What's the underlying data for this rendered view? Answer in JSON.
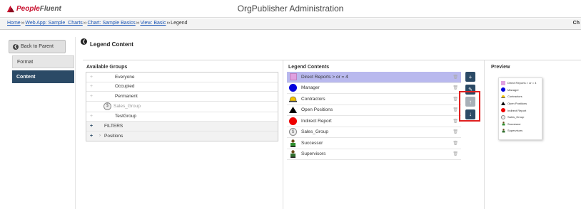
{
  "app": {
    "title": "OrgPublisher Administration",
    "logo_people": "People",
    "logo_fluent": "Fluent",
    "right_label": "Ch"
  },
  "breadcrumb": [
    {
      "label": "Home",
      "link": true
    },
    {
      "label": "Web App: Sample_Charts",
      "link": true
    },
    {
      "label": "Chart: Sample Basics",
      "link": true
    },
    {
      "label": "View: Basic",
      "link": true
    },
    {
      "label": "Legend",
      "link": false
    }
  ],
  "breadcrumb_sep": "››",
  "sidebar": {
    "back_label": "Back to Parent",
    "items": [
      {
        "label": "Format",
        "active": false
      },
      {
        "label": "Content",
        "active": true
      }
    ]
  },
  "page": {
    "title": "Legend Content"
  },
  "available_groups": {
    "header": "Available Groups",
    "rows": [
      {
        "label": "Everyone",
        "type": "group"
      },
      {
        "label": "Occupied",
        "type": "group"
      },
      {
        "label": "Permanent",
        "type": "group"
      },
      {
        "label": "Sales_Group",
        "type": "disabled",
        "icon": "dollar-icon"
      },
      {
        "label": "TestGroup",
        "type": "group"
      },
      {
        "label": "FILTERS",
        "type": "section"
      },
      {
        "label": "Positions",
        "type": "section-expand"
      }
    ]
  },
  "legend_contents": {
    "header": "Legend Contents",
    "rows": [
      {
        "label": "Direct Reports > or = 4",
        "icon": "pink-square-icon",
        "selected": true
      },
      {
        "label": "Manager",
        "icon": "blue-circle-icon",
        "selected": false
      },
      {
        "label": "Contractors",
        "icon": "hardhat-icon",
        "selected": false
      },
      {
        "label": "Open Positions",
        "icon": "black-triangle-icon",
        "selected": false
      },
      {
        "label": "Indirect Report",
        "icon": "red-circle-icon",
        "selected": false
      },
      {
        "label": "Sales_Group",
        "icon": "dollar-icon",
        "selected": false
      },
      {
        "label": "Successor",
        "icon": "successor-person-icon",
        "selected": false
      },
      {
        "label": "Supervisors",
        "icon": "supervisor-person-icon",
        "selected": false
      }
    ]
  },
  "preview": {
    "header": "Preview",
    "rows": [
      {
        "label": "Direct Reports > or = 4",
        "icon": "pink-square-icon"
      },
      {
        "label": "Manager",
        "icon": "blue-circle-icon"
      },
      {
        "label": "Contractors",
        "icon": "hardhat-icon"
      },
      {
        "label": "Open Positions",
        "icon": "black-triangle-icon"
      },
      {
        "label": "Indirect Report",
        "icon": "red-circle-icon"
      },
      {
        "label": "Sales_Group",
        "icon": "dollar-icon"
      },
      {
        "label": "Successor",
        "icon": "successor-person-icon"
      },
      {
        "label": "Supervisors",
        "icon": "supervisor-person-icon"
      }
    ]
  },
  "colors": {
    "accent": "#2b4a66",
    "selected_row": "#b9b9ee",
    "highlight_box": "#e02020",
    "brand_red": "#c8102e"
  }
}
